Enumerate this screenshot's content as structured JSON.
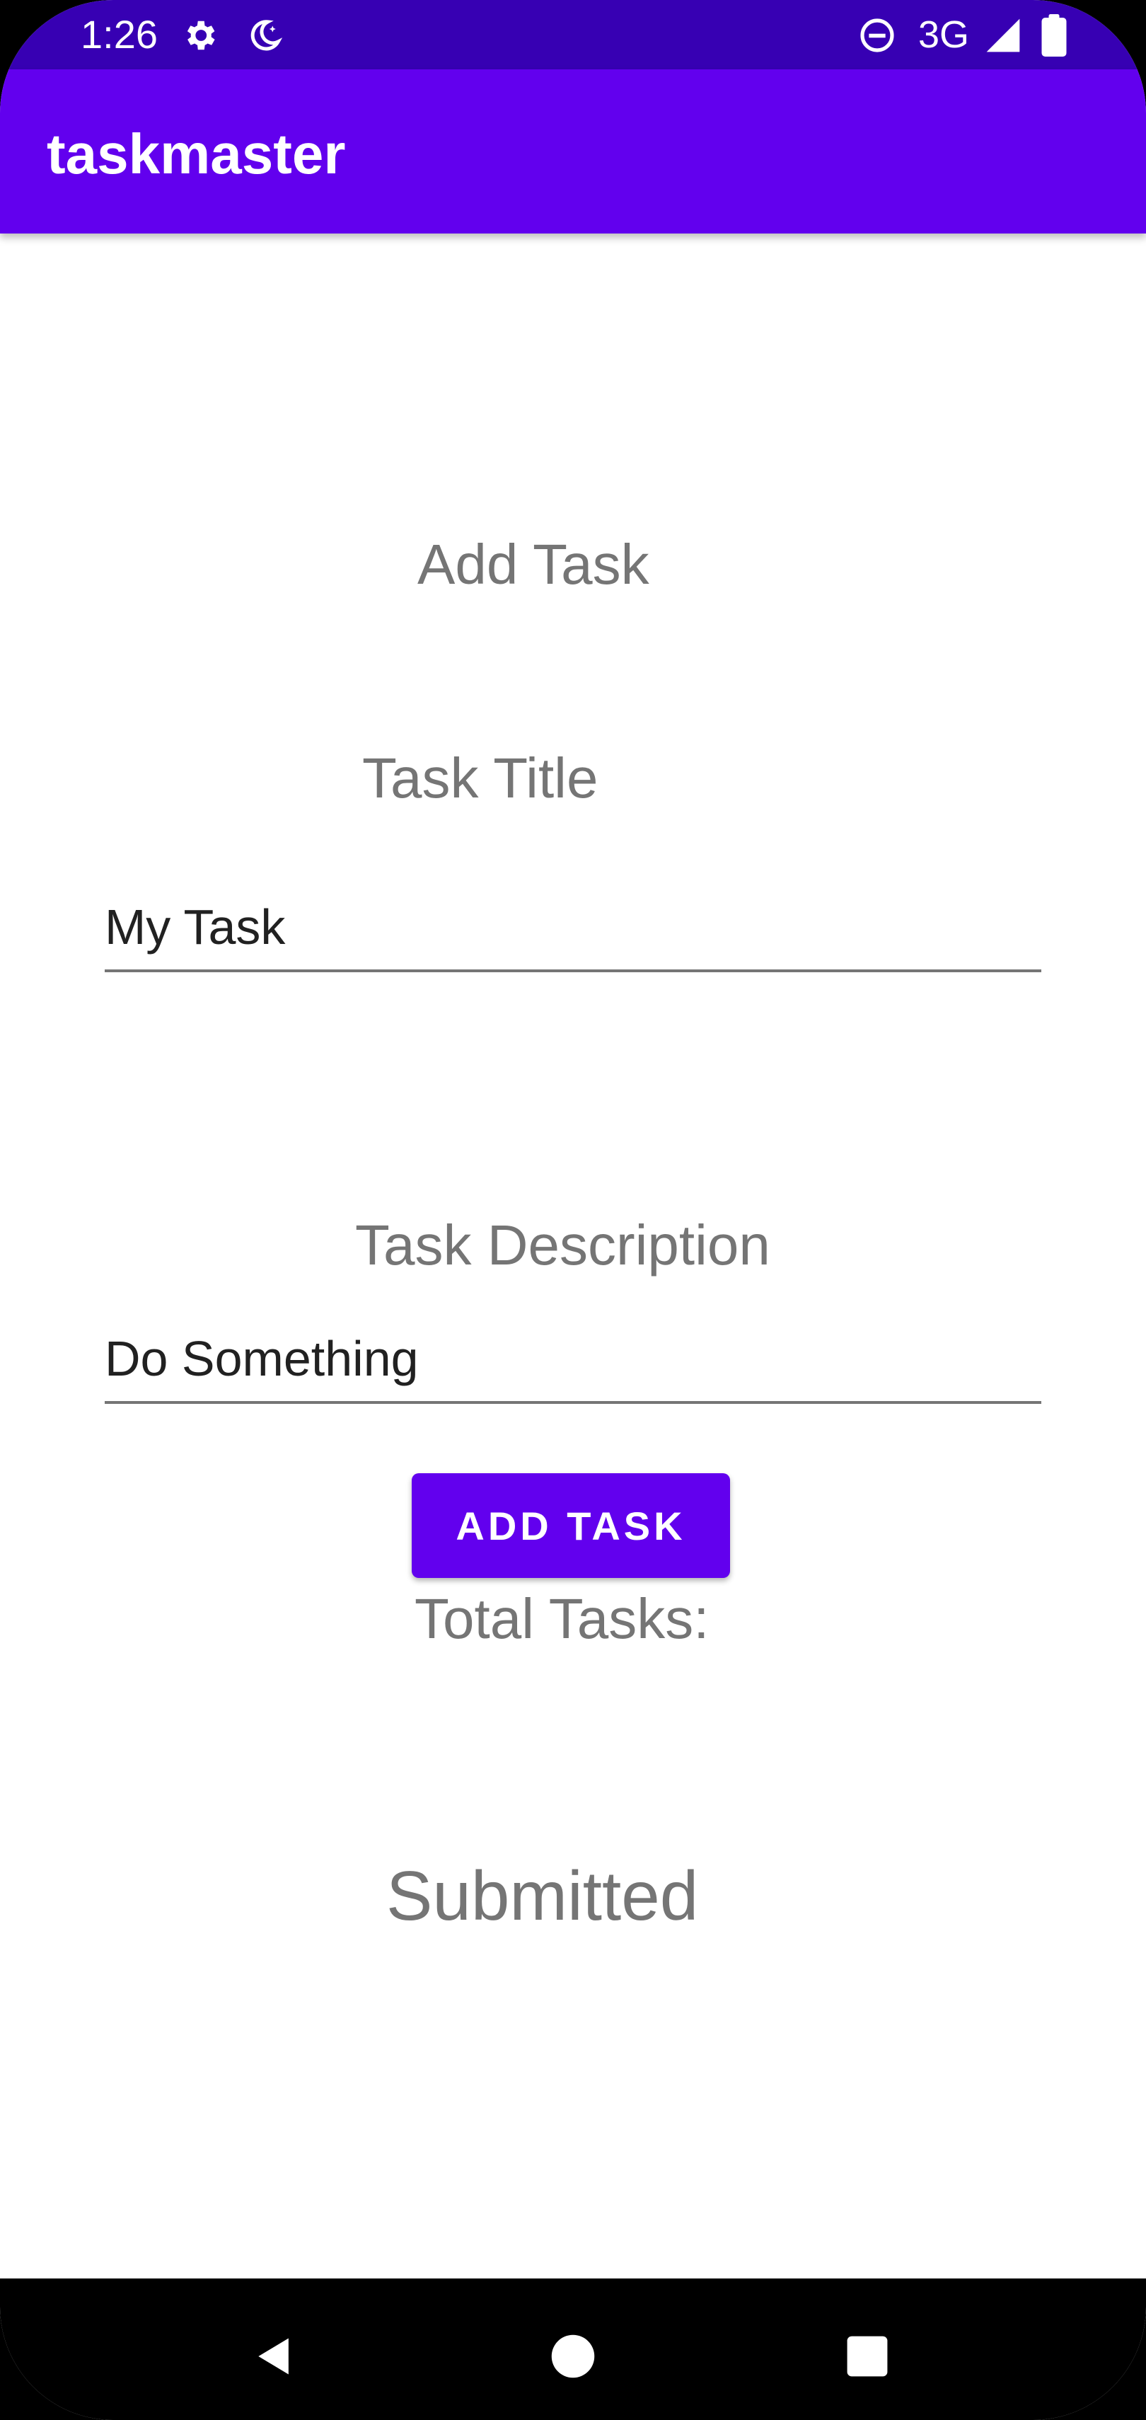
{
  "status_bar": {
    "time": "1:26",
    "network": "3G",
    "icons": [
      "gear-icon",
      "moon-icon",
      "do-not-disturb-icon",
      "signal-icon",
      "battery-icon"
    ]
  },
  "app_bar": {
    "title": "taskmaster"
  },
  "form": {
    "heading": "Add Task",
    "title_label": "Task Title",
    "title_value": "My Task",
    "description_label": "Task Description",
    "description_value": "Do Something",
    "add_button_label": "ADD TASK",
    "total_tasks_label": "Total Tasks:",
    "submitted_text": "Submitted"
  },
  "nav_bar": {
    "buttons": [
      "back-icon",
      "home-icon",
      "recents-icon"
    ]
  },
  "colors": {
    "status_bar": "#3700b3",
    "app_bar": "#6200ee",
    "button": "#6200ee",
    "label_gray": "#757575",
    "text_dark": "#212121"
  }
}
